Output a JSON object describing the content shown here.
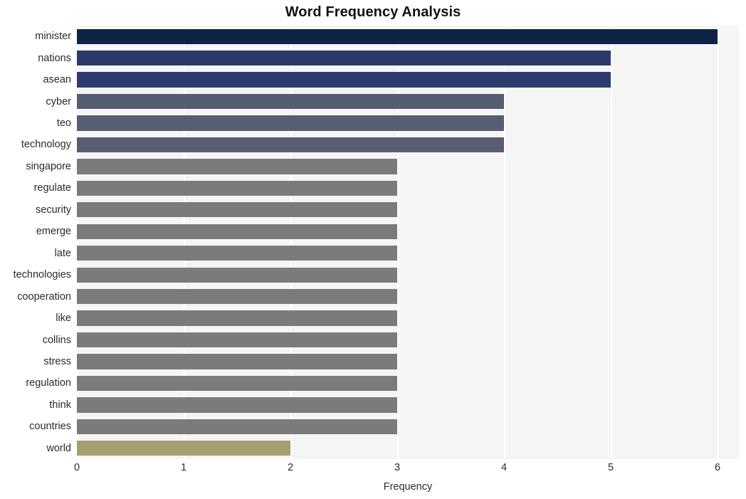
{
  "chart_data": {
    "type": "bar",
    "orientation": "horizontal",
    "title": "Word Frequency Analysis",
    "xlabel": "Frequency",
    "ylabel": "",
    "xlim": [
      0,
      6.2
    ],
    "xticks": [
      "0",
      "1",
      "2",
      "3",
      "4",
      "5",
      "6"
    ],
    "xtick_values": [
      0,
      1,
      2,
      3,
      4,
      5,
      6
    ],
    "grid": "vertical-white",
    "legend": "none",
    "categories": [
      "minister",
      "nations",
      "asean",
      "cyber",
      "teo",
      "technology",
      "singapore",
      "regulate",
      "security",
      "emerge",
      "late",
      "technologies",
      "cooperation",
      "like",
      "collins",
      "stress",
      "regulation",
      "think",
      "countries",
      "world"
    ],
    "values": [
      6,
      5,
      5,
      4,
      4,
      4,
      3,
      3,
      3,
      3,
      3,
      3,
      3,
      3,
      3,
      3,
      3,
      3,
      3,
      2
    ],
    "bar_colors": [
      "#0c2344",
      "#2c3a6b",
      "#2e3c6d",
      "#565d71",
      "#575e72",
      "#575e72",
      "#7b7b79",
      "#7b7b79",
      "#7b7b79",
      "#7b7b79",
      "#7b7b79",
      "#7b7b79",
      "#7b7b79",
      "#7b7b79",
      "#7b7b79",
      "#7b7b79",
      "#7b7b79",
      "#7b7b79",
      "#7b7b79",
      "#a49f70"
    ],
    "plot_background": "#f5f5f6",
    "gridline_color": "#ffffff",
    "title_color": "#111111",
    "tick_label_color": "#2b2b2b"
  }
}
